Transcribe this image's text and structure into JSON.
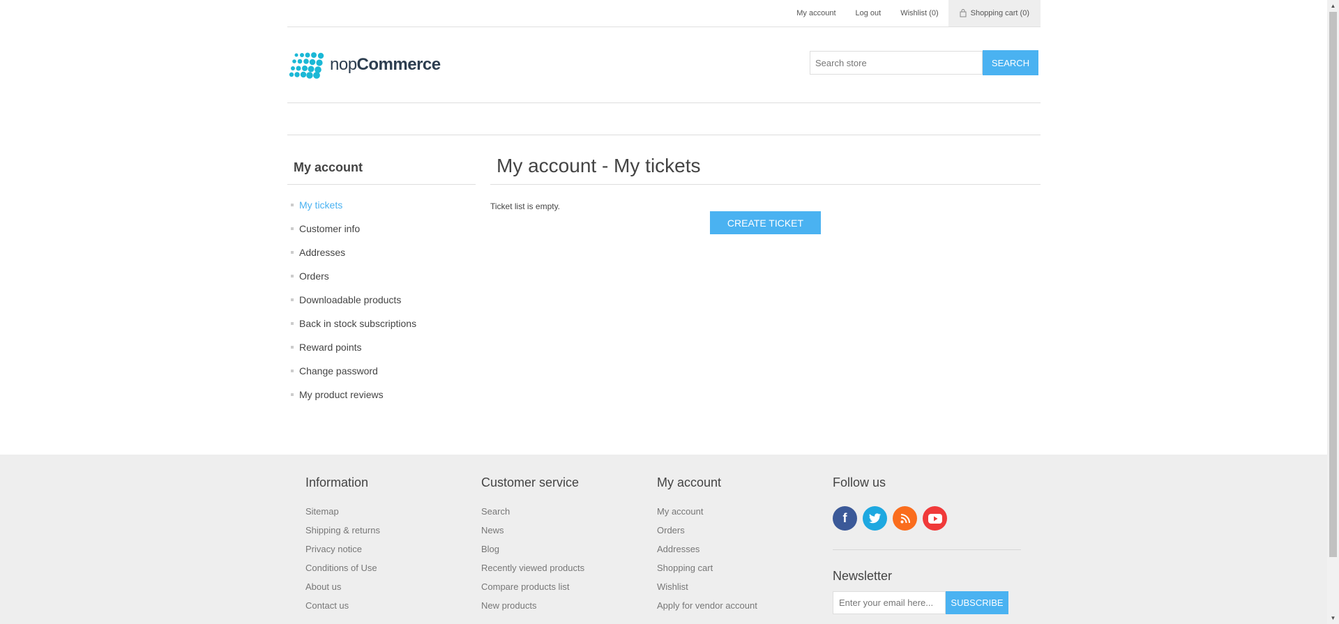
{
  "header": {
    "links": [
      "My account",
      "Log out",
      "Wishlist (0)"
    ],
    "cart_label": "Shopping cart (0)"
  },
  "logo": {
    "part1": "nop",
    "part2": "Commerce",
    "icon": "dots-logo-icon"
  },
  "search": {
    "placeholder": "Search store",
    "button": "SEARCH"
  },
  "sidebar": {
    "title": "My account",
    "items": [
      {
        "label": "My tickets",
        "active": true
      },
      {
        "label": "Customer info"
      },
      {
        "label": "Addresses"
      },
      {
        "label": "Orders"
      },
      {
        "label": "Downloadable products"
      },
      {
        "label": "Back in stock subscriptions"
      },
      {
        "label": "Reward points"
      },
      {
        "label": "Change password"
      },
      {
        "label": "My product reviews"
      }
    ]
  },
  "main": {
    "title": "My account - My tickets",
    "empty_message": "Ticket list is empty.",
    "create_button": "CREATE TICKET"
  },
  "footer": {
    "information": {
      "title": "Information",
      "links": [
        "Sitemap",
        "Shipping & returns",
        "Privacy notice",
        "Conditions of Use",
        "About us",
        "Contact us"
      ]
    },
    "customer_service": {
      "title": "Customer service",
      "links": [
        "Search",
        "News",
        "Blog",
        "Recently viewed products",
        "Compare products list",
        "New products"
      ]
    },
    "my_account": {
      "title": "My account",
      "links": [
        "My account",
        "Orders",
        "Addresses",
        "Shopping cart",
        "Wishlist",
        "Apply for vendor account"
      ]
    },
    "follow": {
      "title": "Follow us",
      "icons": [
        "facebook-icon",
        "twitter-icon",
        "rss-icon",
        "youtube-icon"
      ]
    },
    "newsletter": {
      "title": "Newsletter",
      "placeholder": "Enter your email here...",
      "button": "SUBSCRIBE"
    }
  },
  "colors": {
    "accent": "#4ab2f1",
    "footer_bg": "#eeeeee"
  }
}
